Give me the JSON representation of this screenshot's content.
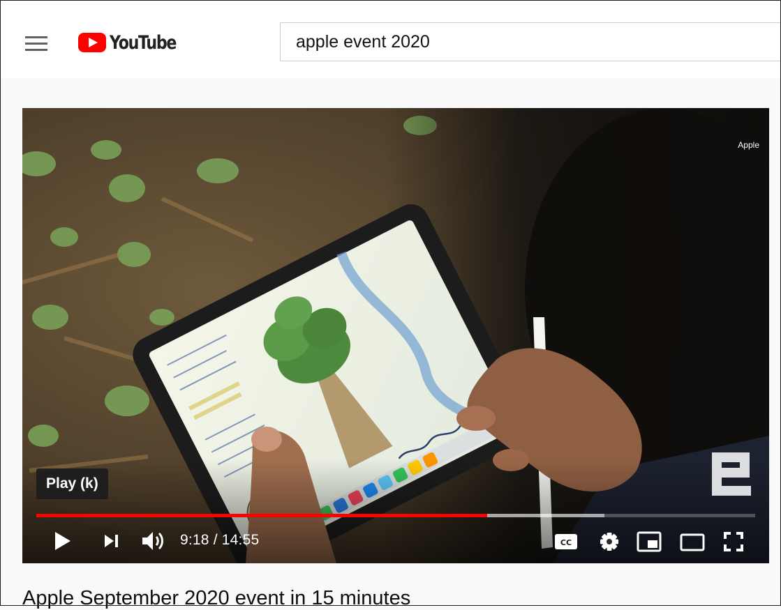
{
  "header": {
    "logo_text": "YouTube",
    "search_value": "apple event 2020"
  },
  "player": {
    "channel_watermark": "Apple",
    "tooltip": "Play (k)",
    "time_current": "9:18",
    "time_separator": " / ",
    "time_total": "14:55",
    "progress_played_fraction": 0.627,
    "progress_loaded_fraction": 0.79,
    "controls": [
      "play-icon",
      "next-icon",
      "volume-icon",
      "captions-icon",
      "settings-icon",
      "miniplayer-icon",
      "theater-mode-icon",
      "fullscreen-icon"
    ],
    "captions_label": "CC"
  },
  "video": {
    "title": "Apple September 2020 event in 15 minutes"
  },
  "colors": {
    "brand_red": "#ff0000",
    "header_bg": "#ffffff",
    "page_bg": "#f9f9f9"
  }
}
